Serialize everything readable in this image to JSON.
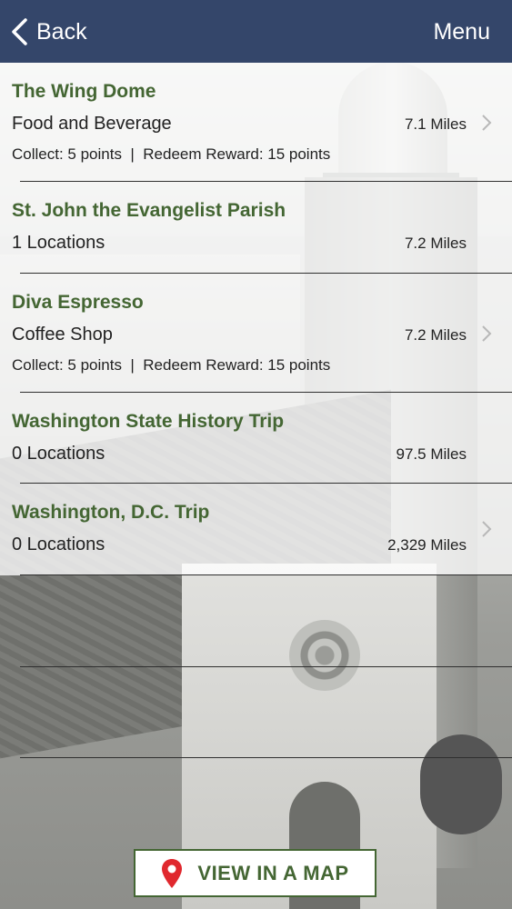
{
  "nav": {
    "back_label": "Back",
    "menu_label": "Menu",
    "color": "#34466a"
  },
  "accent": "#446633",
  "items": [
    {
      "title": "The Wing Dome",
      "subtitle": "Food and Beverage",
      "distance": "7.1 Miles",
      "extra": "Collect: 5 points  |  Redeem Reward: 15 points",
      "chevron": true
    },
    {
      "title": "St. John the Evangelist Parish",
      "subtitle": "1 Locations",
      "distance": "7.2 Miles",
      "extra": "",
      "chevron": false
    },
    {
      "title": "Diva Espresso",
      "subtitle": "Coffee Shop",
      "distance": "7.2 Miles",
      "extra": "Collect: 5 points  |  Redeem Reward: 15 points",
      "chevron": true
    },
    {
      "title": "Washington State History Trip",
      "subtitle": "0 Locations",
      "distance": "97.5 Miles",
      "extra": "",
      "chevron": false
    },
    {
      "title": "Washington, D.C. Trip",
      "subtitle": "0 Locations",
      "distance": "2,329 Miles",
      "extra": "",
      "chevron": true
    }
  ],
  "map_button": {
    "label": "VIEW IN A MAP",
    "icon": "map-pin-icon",
    "pin_color": "#e0282e"
  }
}
